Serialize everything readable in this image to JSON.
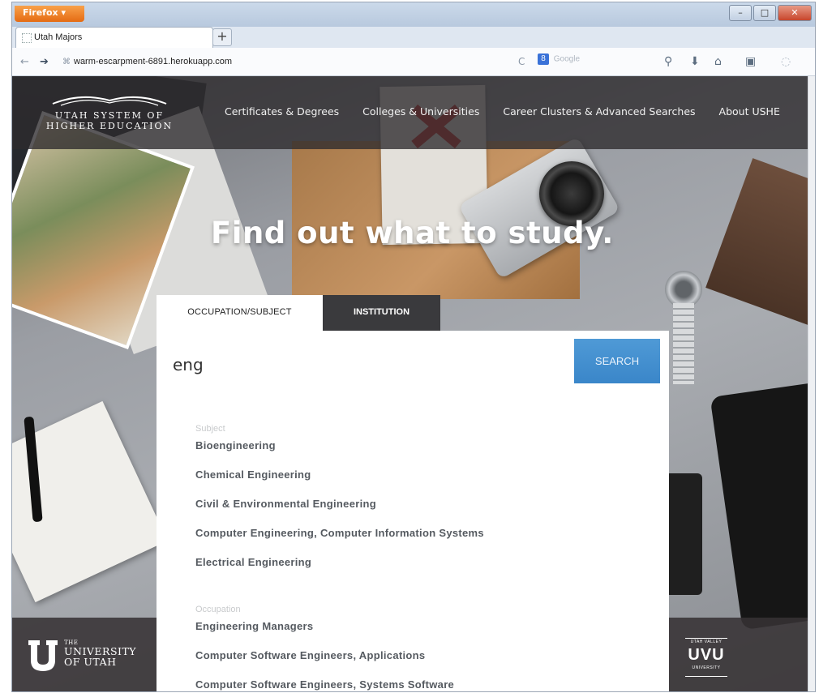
{
  "browser": {
    "app_button": "Firefox",
    "tab_title": "Utah Majors",
    "new_tab": "+",
    "url": "warm-escarpment-6891.herokuapp.com",
    "search_placeholder": "Google"
  },
  "site": {
    "logo_line1": "UTAH SYSTEM OF",
    "logo_line2": "HIGHER EDUCATION",
    "nav": [
      {
        "label": "Certificates & Degrees"
      },
      {
        "label": "Colleges & Universities"
      },
      {
        "label": "Career Clusters & Advanced Searches"
      },
      {
        "label": "About USHE"
      }
    ],
    "hero_title": "Find out what to study."
  },
  "search": {
    "tabs": [
      {
        "label": "OCCUPATION/SUBJECT"
      },
      {
        "label": "INSTITUTION"
      }
    ],
    "query": "eng",
    "button_label": "SEARCH",
    "groups": [
      {
        "heading": "Subject",
        "items": [
          "Bioengineering",
          "Chemical Engineering",
          "Civil & Environmental Engineering",
          "Computer Engineering, Computer Information Systems",
          "Electrical Engineering"
        ]
      },
      {
        "heading": "Occupation",
        "items": [
          "Engineering Managers",
          "Computer Software Engineers, Applications",
          "Computer Software Engineers, Systems Software"
        ]
      }
    ]
  },
  "footer": {
    "uofu_the": "THE",
    "uofu_line1": "UNIVERSITY",
    "uofu_line2": "OF UTAH",
    "uvu_top": "UTAH VALLEY",
    "uvu_mid": "UVU",
    "uvu_bottom": "UNIVERSITY"
  },
  "colors": {
    "search_button": "#3a86c9",
    "header_bg": "#2d2a2d",
    "institution_tab": "#3a3a3d"
  }
}
